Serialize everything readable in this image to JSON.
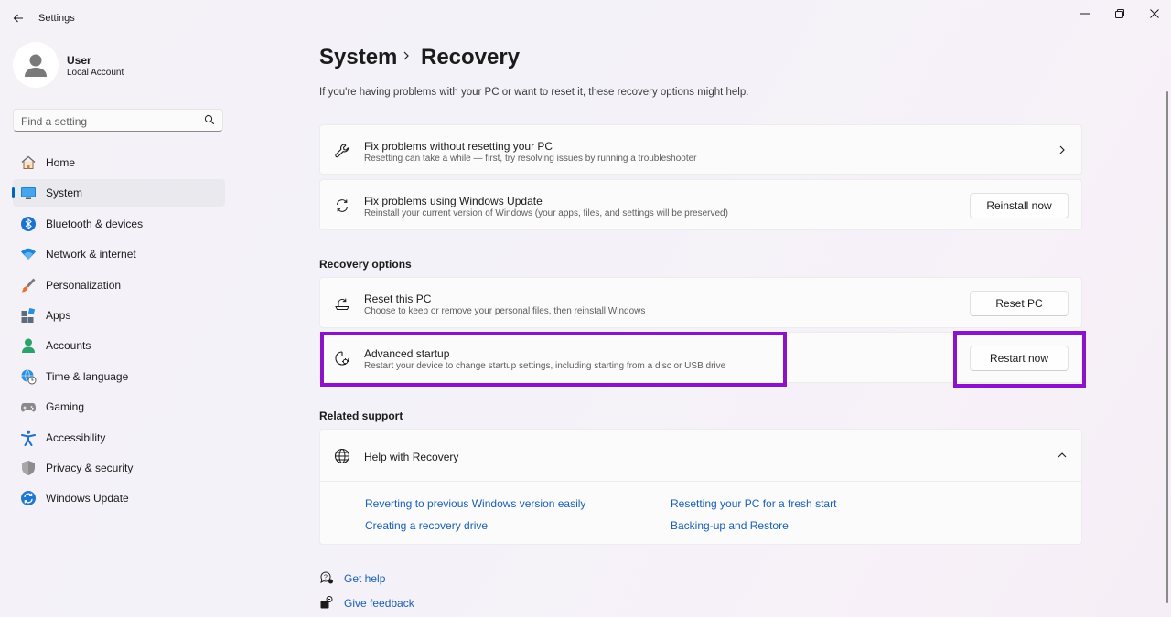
{
  "window": {
    "title": "Settings",
    "back_icon": "back-arrow-icon",
    "controls": [
      "minimize-icon",
      "restore-icon",
      "close-icon"
    ]
  },
  "profile": {
    "name": "User",
    "account_type": "Local Account"
  },
  "search": {
    "placeholder": "Find a setting"
  },
  "nav": {
    "selected": "System",
    "items": [
      {
        "label": "Home",
        "icon": "home-icon"
      },
      {
        "label": "System",
        "icon": "system-display-icon"
      },
      {
        "label": "Bluetooth & devices",
        "icon": "bluetooth-icon"
      },
      {
        "label": "Network & internet",
        "icon": "wifi-icon"
      },
      {
        "label": "Personalization",
        "icon": "brush-icon"
      },
      {
        "label": "Apps",
        "icon": "apps-icon"
      },
      {
        "label": "Accounts",
        "icon": "person-icon"
      },
      {
        "label": "Time & language",
        "icon": "globe-clock-icon"
      },
      {
        "label": "Gaming",
        "icon": "gamepad-icon"
      },
      {
        "label": "Accessibility",
        "icon": "accessibility-icon"
      },
      {
        "label": "Privacy & security",
        "icon": "shield-icon"
      },
      {
        "label": "Windows Update",
        "icon": "update-icon"
      }
    ]
  },
  "breadcrumb": {
    "parent": "System",
    "current": "Recovery"
  },
  "subtitle": "If you're having problems with your PC or want to reset it, these recovery options might help.",
  "cards": {
    "fix_no_reset": {
      "title": "Fix problems without resetting your PC",
      "desc": "Resetting can take a while — first, try resolving issues by running a troubleshooter"
    },
    "fix_update": {
      "title": "Fix problems using Windows Update",
      "desc": "Reinstall your current version of Windows (your apps, files, and settings will be preserved)",
      "button": "Reinstall now"
    }
  },
  "recovery_options": {
    "heading": "Recovery options",
    "reset": {
      "title": "Reset this PC",
      "desc": "Choose to keep or remove your personal files, then reinstall Windows",
      "button": "Reset PC"
    },
    "advanced": {
      "title": "Advanced startup",
      "desc": "Restart your device to change startup settings, including starting from a disc or USB drive",
      "button": "Restart now"
    }
  },
  "highlight_color": "#8b14c9",
  "accent_color": "#0067c0",
  "link_color": "#1a5fb4",
  "related_support": {
    "heading": "Related support",
    "help_title": "Help with Recovery",
    "links": [
      "Reverting to previous Windows version easily",
      "Resetting your PC for a fresh start",
      "Creating a recovery drive",
      "Backing-up and Restore"
    ]
  },
  "footer": {
    "get_help": "Get help",
    "give_feedback": "Give feedback"
  }
}
